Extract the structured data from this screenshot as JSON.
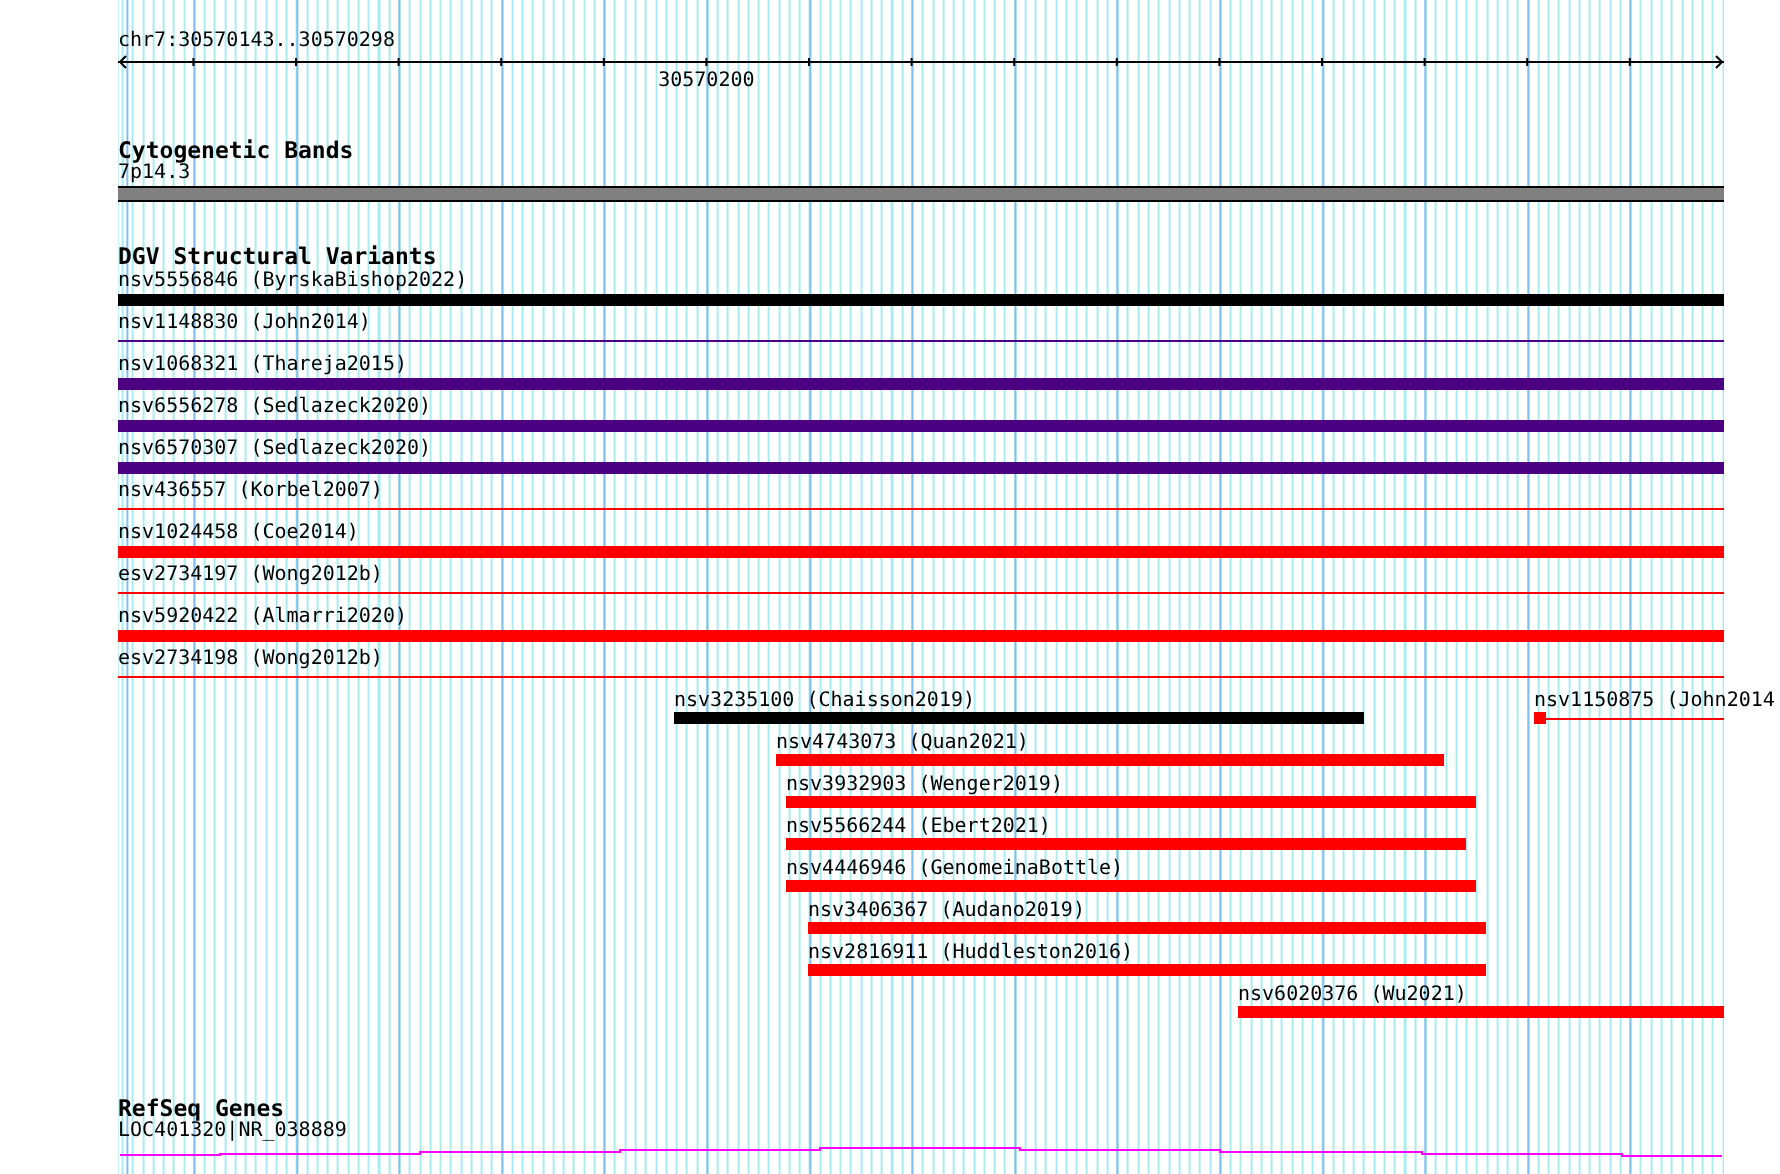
{
  "ruler": {
    "position": "chr7:30570143..30570298",
    "tick_label": "30570200"
  },
  "tracks": [
    {
      "kind": "bands",
      "title": "Cytogenetic Bands",
      "items": [
        {
          "label": "7p14.3",
          "color": "#808080"
        }
      ]
    },
    {
      "kind": "variants",
      "title": "DGV Structural Variants",
      "items": [
        {
          "label": "nsv5556846 (ByrskaBishop2022)",
          "kind": "bar",
          "color": "#000000"
        },
        {
          "label": "nsv1148830 (John2014)",
          "kind": "line",
          "color": "#4b0082"
        },
        {
          "label": "nsv1068321 (Thareja2015)",
          "kind": "bar",
          "color": "#4b0082"
        },
        {
          "label": "nsv6556278 (Sedlazeck2020)",
          "kind": "bar",
          "color": "#4b0082"
        },
        {
          "label": "nsv6570307 (Sedlazeck2020)",
          "kind": "bar",
          "color": "#4b0082"
        },
        {
          "label": "nsv436557 (Korbel2007)",
          "kind": "line",
          "color": "#ff0000"
        },
        {
          "label": "nsv1024458 (Coe2014)",
          "kind": "bar",
          "color": "#ff0000"
        },
        {
          "label": "esv2734197 (Wong2012b)",
          "kind": "line",
          "color": "#ff0000"
        },
        {
          "label": "nsv5920422 (Almarri2020)",
          "kind": "bar",
          "color": "#ff0000"
        },
        {
          "label": "esv2734198 (Wong2012b)",
          "kind": "line",
          "color": "#ff0000"
        },
        {
          "label": "nsv3235100 (Chaisson2019)",
          "kind": "bar",
          "color": "#000000"
        },
        {
          "label": "nsv1150875 (John2014",
          "kind": "block-line",
          "color": "#ff0000"
        },
        {
          "label": "nsv4743073 (Quan2021)",
          "kind": "bar",
          "color": "#ff0000"
        },
        {
          "label": "nsv3932903 (Wenger2019)",
          "kind": "bar",
          "color": "#ff0000"
        },
        {
          "label": "nsv5566244 (Ebert2021)",
          "kind": "bar",
          "color": "#ff0000"
        },
        {
          "label": "nsv4446946 (GenomeinaBottle)",
          "kind": "bar",
          "color": "#ff0000"
        },
        {
          "label": "nsv3406367 (Audano2019)",
          "kind": "bar",
          "color": "#ff0000"
        },
        {
          "label": "nsv2816911 (Huddleston2016)",
          "kind": "bar",
          "color": "#ff0000"
        },
        {
          "label": "nsv6020376 (Wu2021)",
          "kind": "bar",
          "color": "#ff0000"
        }
      ]
    },
    {
      "kind": "genes",
      "title": "RefSeq Genes",
      "items": [
        {
          "label": "LOC401320|NR_038889",
          "color": "#ff00ff"
        }
      ]
    }
  ]
}
